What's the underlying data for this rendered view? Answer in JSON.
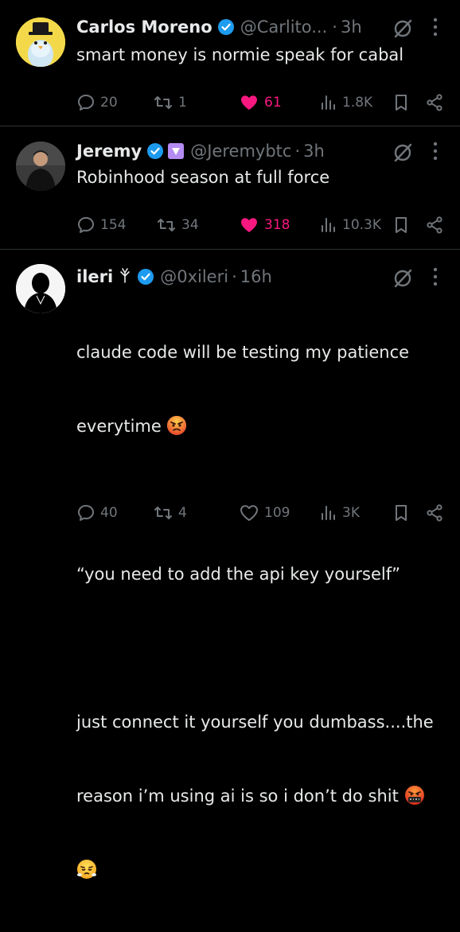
{
  "tweets": [
    {
      "name": "Carlos Moreno",
      "handle": "@Carlito...",
      "sep": "·",
      "time": "3h",
      "text": "smart money is normie speak for cabal",
      "replies": "20",
      "reposts": "1",
      "likes": "61",
      "views": "1.8K",
      "liked": true
    },
    {
      "name": "Jeremy",
      "handle": "@Jeremybtc",
      "sep": "·",
      "time": "3h",
      "text": "Robinhood season at full force",
      "replies": "154",
      "reposts": "34",
      "likes": "318",
      "views": "10.3K",
      "liked": true
    },
    {
      "name": "ileri",
      "handle": "@0xileri",
      "sep": "·",
      "time": "16h",
      "text_line1": "claude code will be testing my patience",
      "text_line2": "everytime",
      "text_line3": "“you need to add the api key yourself”",
      "text_line4": "just connect it yourself you dumbass....the",
      "text_line5": "reason i’m using ai is so i don’t do shit",
      "replies": "40",
      "reposts": "4",
      "likes": "109",
      "views": "3K",
      "liked": false
    }
  ],
  "colors": {
    "background": "#000000",
    "text": "#e7e9ea",
    "muted": "#71767b",
    "verified": "#1d9bf0",
    "like": "#f91880",
    "divider": "#2f3336"
  },
  "icons": [
    "verified-badge-icon",
    "affiliate-badge-icon",
    "grok-icon",
    "more-icon",
    "reply-icon",
    "repost-icon",
    "like-icon",
    "views-icon",
    "bookmark-icon",
    "share-icon",
    "angry-emoji-icon",
    "cursing-emoji-icon",
    "steam-emoji-icon"
  ]
}
